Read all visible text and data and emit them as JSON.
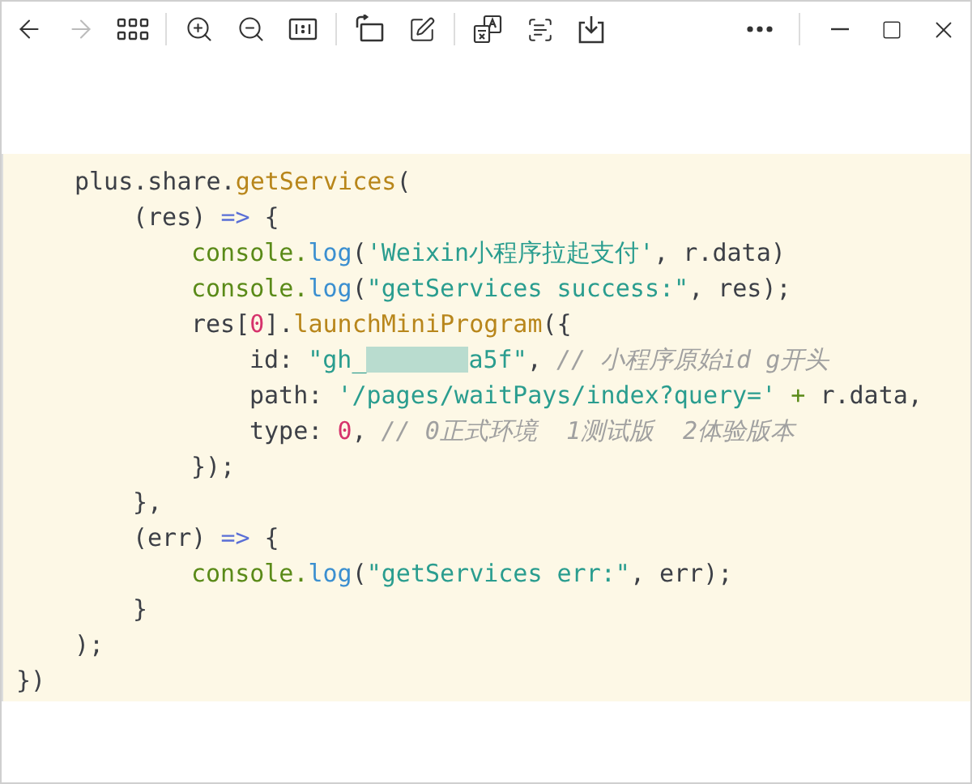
{
  "toolbar": {
    "navigation": [
      {
        "kind": "back",
        "disabled": false
      },
      {
        "kind": "forward",
        "disabled": true
      }
    ]
  },
  "code_image": {
    "body": [
      {
        "tokens": [
          {
            "kind": "plain",
            "text": "plus.share."
          },
          {
            "kind": "func",
            "text": "getServices"
          },
          {
            "kind": "plain",
            "text": "("
          }
        ],
        "children": [
          {
            "tokens": [
              {
                "kind": "plain",
                "text": "(res) "
              },
              {
                "kind": "keyword",
                "text": "=>"
              },
              {
                "kind": "plain",
                "text": " {"
              }
            ],
            "children": [
              {
                "tokens": [
                  {
                    "kind": "object",
                    "text": "console."
                  },
                  {
                    "kind": "method",
                    "text": "log"
                  },
                  {
                    "kind": "plain",
                    "text": "("
                  },
                  {
                    "kind": "string",
                    "text": "'Weixin小程序拉起支付'"
                  },
                  {
                    "kind": "plain",
                    "text": ", r.data)"
                  }
                ]
              },
              {
                "tokens": [
                  {
                    "kind": "object",
                    "text": "console."
                  },
                  {
                    "kind": "method",
                    "text": "log"
                  },
                  {
                    "kind": "plain",
                    "text": "("
                  },
                  {
                    "kind": "string",
                    "text": "\"getServices success:\""
                  },
                  {
                    "kind": "plain",
                    "text": ", res);"
                  }
                ]
              },
              {
                "tokens": [
                  {
                    "kind": "plain",
                    "text": "res["
                  },
                  {
                    "kind": "number",
                    "text": "0"
                  },
                  {
                    "kind": "plain",
                    "text": "]."
                  },
                  {
                    "kind": "func",
                    "text": "launchMiniProgram"
                  },
                  {
                    "kind": "plain",
                    "text": "({"
                  }
                ],
                "children": [
                  {
                    "tokens": [
                      {
                        "kind": "plain",
                        "text": "id: "
                      },
                      {
                        "kind": "string",
                        "text": "\"gh_"
                      },
                      {
                        "kind": "redacted"
                      },
                      {
                        "kind": "string",
                        "text": "a5f\""
                      },
                      {
                        "kind": "plain",
                        "text": ", "
                      },
                      {
                        "kind": "comment",
                        "text": "// 小程序原始id g开头"
                      }
                    ]
                  },
                  {
                    "tokens": [
                      {
                        "kind": "plain",
                        "text": "path: "
                      },
                      {
                        "kind": "string",
                        "text": "'/pages/waitPays/index?query='"
                      },
                      {
                        "kind": "operator",
                        "text": " +"
                      },
                      {
                        "kind": "plain",
                        "text": " r.data,"
                      }
                    ]
                  },
                  {
                    "tokens": [
                      {
                        "kind": "plain",
                        "text": "type: "
                      },
                      {
                        "kind": "number",
                        "text": "0"
                      },
                      {
                        "kind": "plain",
                        "text": ", "
                      },
                      {
                        "kind": "comment",
                        "text": "// 0正式环境  1测试版  2体验版本"
                      }
                    ]
                  }
                ]
              },
              {
                "tokens": [
                  {
                    "kind": "plain",
                    "text": "});"
                  }
                ]
              }
            ]
          },
          {
            "tokens": [
              {
                "kind": "plain",
                "text": "},"
              }
            ]
          },
          {
            "tokens": [
              {
                "kind": "plain",
                "text": "(err) "
              },
              {
                "kind": "keyword",
                "text": "=>"
              },
              {
                "kind": "plain",
                "text": " {"
              }
            ],
            "children": [
              {
                "tokens": [
                  {
                    "kind": "object",
                    "text": "console."
                  },
                  {
                    "kind": "method",
                    "text": "log"
                  },
                  {
                    "kind": "plain",
                    "text": "("
                  },
                  {
                    "kind": "string",
                    "text": "\"getServices err:\""
                  },
                  {
                    "kind": "plain",
                    "text": ", err);"
                  }
                ]
              }
            ]
          },
          {
            "tokens": [
              {
                "kind": "plain",
                "text": "}"
              }
            ]
          }
        ]
      },
      {
        "tokens": [
          {
            "kind": "plain",
            "text": ");"
          }
        ]
      }
    ],
    "closing": {
      "tokens": [
        {
          "kind": "plain",
          "text": "})"
        }
      ]
    }
  }
}
